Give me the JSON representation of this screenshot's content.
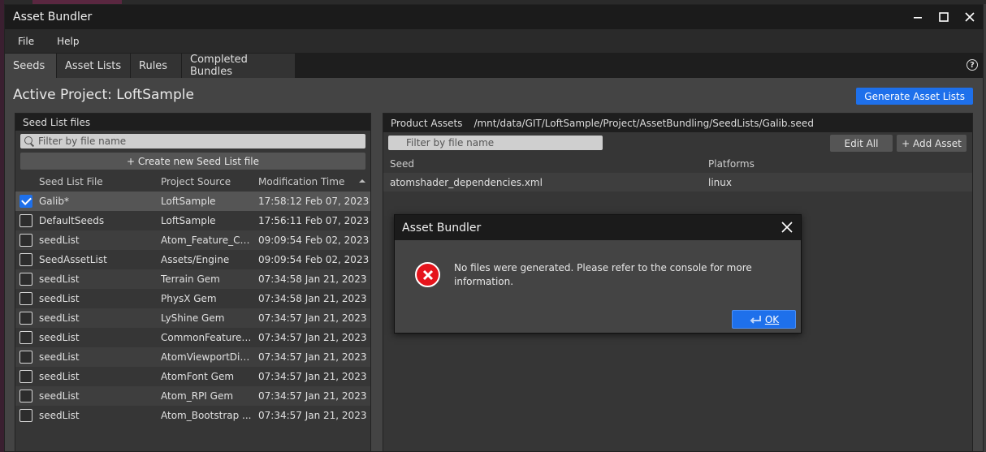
{
  "window": {
    "title": "Asset Bundler"
  },
  "menu": [
    "File",
    "Help"
  ],
  "tabs": [
    "Seeds",
    "Asset Lists",
    "Rules",
    "Completed Bundles"
  ],
  "project": {
    "title": "Active Project: LoftSample",
    "generate_label": "Generate Asset Lists"
  },
  "seed_panel": {
    "header": "Seed List files",
    "filter_placeholder": "Filter by file name",
    "create_label": "+ Create new Seed List file",
    "columns": [
      "Seed List File",
      "Project Source",
      "Modification Time"
    ],
    "rows": [
      {
        "file": "Galib*",
        "source": "LoftSample",
        "time": "17:58:12 Feb 07, 2023",
        "checked": true
      },
      {
        "file": "DefaultSeeds",
        "source": "LoftSample",
        "time": "17:56:11 Feb 07, 2023",
        "checked": false
      },
      {
        "file": "seedList",
        "source": "Atom_Feature_Co...",
        "time": "09:09:54 Feb 02, 2023",
        "checked": false
      },
      {
        "file": "SeedAssetList",
        "source": "Assets/Engine",
        "time": "09:09:54 Feb 02, 2023",
        "checked": false
      },
      {
        "file": "seedList",
        "source": "Terrain Gem",
        "time": "07:34:58 Jan 21, 2023",
        "checked": false
      },
      {
        "file": "seedList",
        "source": "PhysX Gem",
        "time": "07:34:58 Jan 21, 2023",
        "checked": false
      },
      {
        "file": "seedList",
        "source": "LyShine Gem",
        "time": "07:34:57 Jan 21, 2023",
        "checked": false
      },
      {
        "file": "seedList",
        "source": "CommonFeatures...",
        "time": "07:34:57 Jan 21, 2023",
        "checked": false
      },
      {
        "file": "seedList",
        "source": "AtomViewportDis...",
        "time": "07:34:57 Jan 21, 2023",
        "checked": false
      },
      {
        "file": "seedList",
        "source": "AtomFont Gem",
        "time": "07:34:57 Jan 21, 2023",
        "checked": false
      },
      {
        "file": "seedList",
        "source": "Atom_RPI Gem",
        "time": "07:34:57 Jan 21, 2023",
        "checked": false
      },
      {
        "file": "seedList",
        "source": "Atom_Bootstrap ...",
        "time": "07:34:57 Jan 21, 2023",
        "checked": false
      }
    ]
  },
  "product_panel": {
    "header": "Product Assets",
    "path": "/mnt/data/GIT/LoftSample/Project/AssetBundling/SeedLists/Galib.seed",
    "filter_placeholder": "Filter by file name",
    "edit_all_label": "Edit All",
    "add_asset_label": "+ Add Asset",
    "columns": [
      "Seed",
      "Platforms"
    ],
    "rows": [
      {
        "seed": "atomshader_dependencies.xml",
        "platform": "linux"
      }
    ]
  },
  "dialog": {
    "title": "Asset Bundler",
    "message": "No files were generated. Please refer to the console for more information.",
    "ok_label": "OK"
  },
  "colors": {
    "accent": "#1e70eb",
    "error": "#e5141c"
  }
}
